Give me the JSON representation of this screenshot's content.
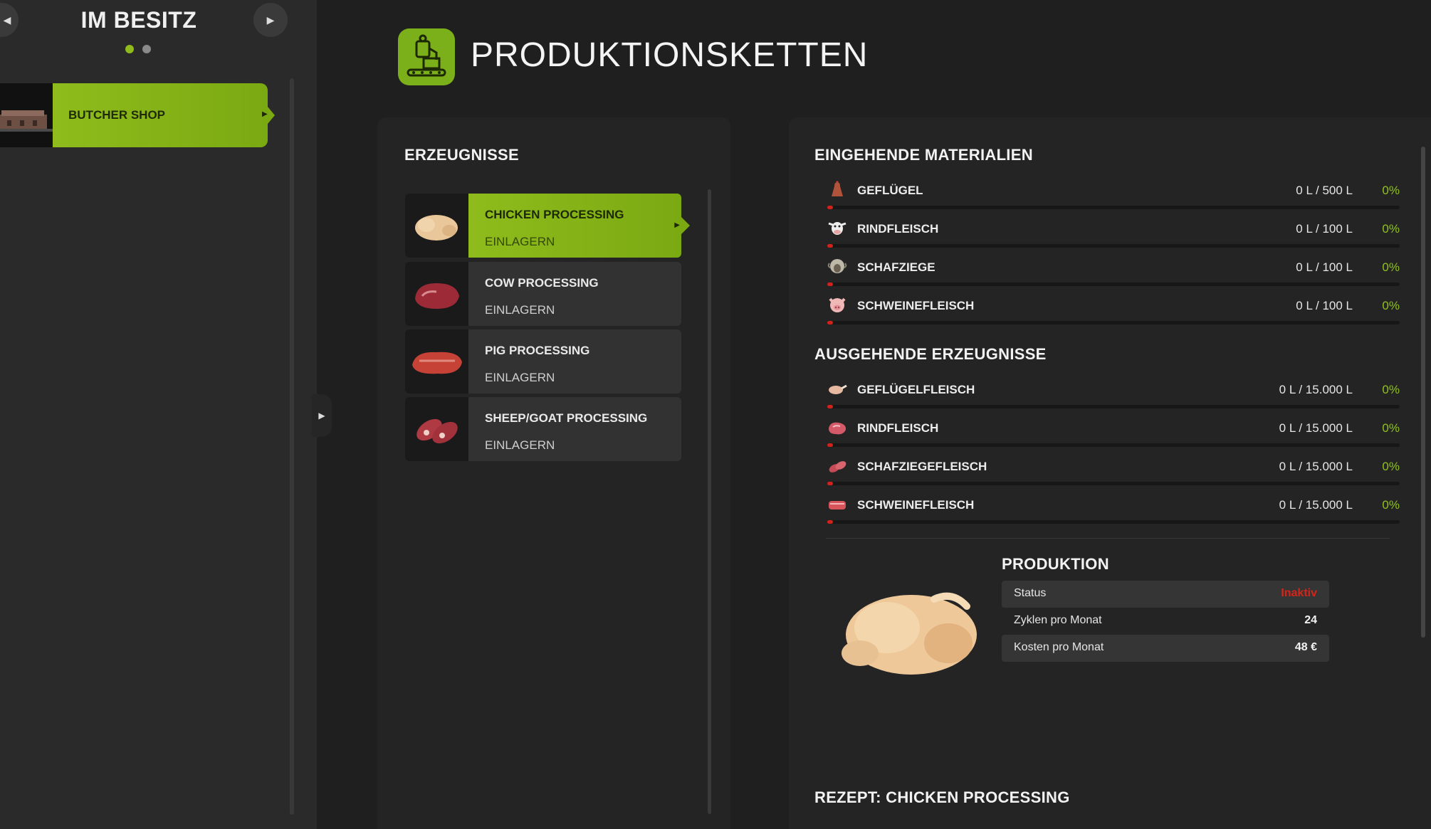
{
  "sidebar": {
    "title": "IM BESITZ",
    "prev_icon": "chevron-left-icon",
    "next_icon": "chevron-right-icon",
    "page_dots": {
      "count": 2,
      "active": 0
    },
    "items": [
      {
        "label": "BUTCHER SHOP",
        "selected": true
      }
    ],
    "collapse_icon": "chevron-right-icon"
  },
  "header": {
    "title": "PRODUKTIONSKETTEN",
    "icon": "production-chain-icon"
  },
  "products": {
    "title": "ERZEUGNISSE",
    "items": [
      {
        "name": "CHICKEN PROCESSING",
        "sub": "EINLAGERN",
        "icon": "raw-chicken",
        "selected": true
      },
      {
        "name": "COW PROCESSING",
        "sub": "EINLAGERN",
        "icon": "beef-cut"
      },
      {
        "name": "PIG PROCESSING",
        "sub": "EINLAGERN",
        "icon": "pork-cut"
      },
      {
        "name": "SHEEP/GOAT PROCESSING",
        "sub": "EINLAGERN",
        "icon": "lamb-cut"
      }
    ]
  },
  "incoming": {
    "title": "EINGEHENDE MATERIALIEN",
    "items": [
      {
        "name": "GEFLÜGEL",
        "amount": "0 L / 500 L",
        "percent": "0%",
        "fill": 0,
        "icon": "chicken-icon"
      },
      {
        "name": "RINDFLEISCH",
        "amount": "0 L / 100 L",
        "percent": "0%",
        "fill": 0,
        "icon": "cow-icon"
      },
      {
        "name": "SCHAFZIEGE",
        "amount": "0 L / 100 L",
        "percent": "0%",
        "fill": 0,
        "icon": "sheep-icon"
      },
      {
        "name": "SCHWEINEFLEISCH",
        "amount": "0 L / 100 L",
        "percent": "0%",
        "fill": 0,
        "icon": "pig-icon"
      }
    ]
  },
  "outgoing": {
    "title": "AUSGEHENDE ERZEUGNISSE",
    "items": [
      {
        "name": "GEFLÜGELFLEISCH",
        "amount": "0 L / 15.000 L",
        "percent": "0%",
        "fill": 0,
        "icon": "poultry-meat-icon"
      },
      {
        "name": "RINDFLEISCH",
        "amount": "0 L / 15.000 L",
        "percent": "0%",
        "fill": 0,
        "icon": "beef-meat-icon"
      },
      {
        "name": "SCHAFZIEGEFLEISCH",
        "amount": "0 L / 15.000 L",
        "percent": "0%",
        "fill": 0,
        "icon": "lamb-meat-icon"
      },
      {
        "name": "SCHWEINEFLEISCH",
        "amount": "0 L / 15.000 L",
        "percent": "0%",
        "fill": 0,
        "icon": "pork-meat-icon"
      }
    ]
  },
  "production": {
    "title": "PRODUKTION",
    "image": "raw-chicken",
    "rows": [
      {
        "label": "Status",
        "value": "Inaktiv",
        "status_color": "#d4251b"
      },
      {
        "label": "Zyklen pro Monat",
        "value": "24"
      },
      {
        "label": "Kosten pro Monat",
        "value": "48 €"
      }
    ]
  },
  "recipe": {
    "title": "REZEPT: CHICKEN PROCESSING"
  },
  "colors": {
    "accent": "#8fbc1c",
    "danger": "#d4251b",
    "panel": "#242424",
    "background": "#1f1f1f"
  }
}
